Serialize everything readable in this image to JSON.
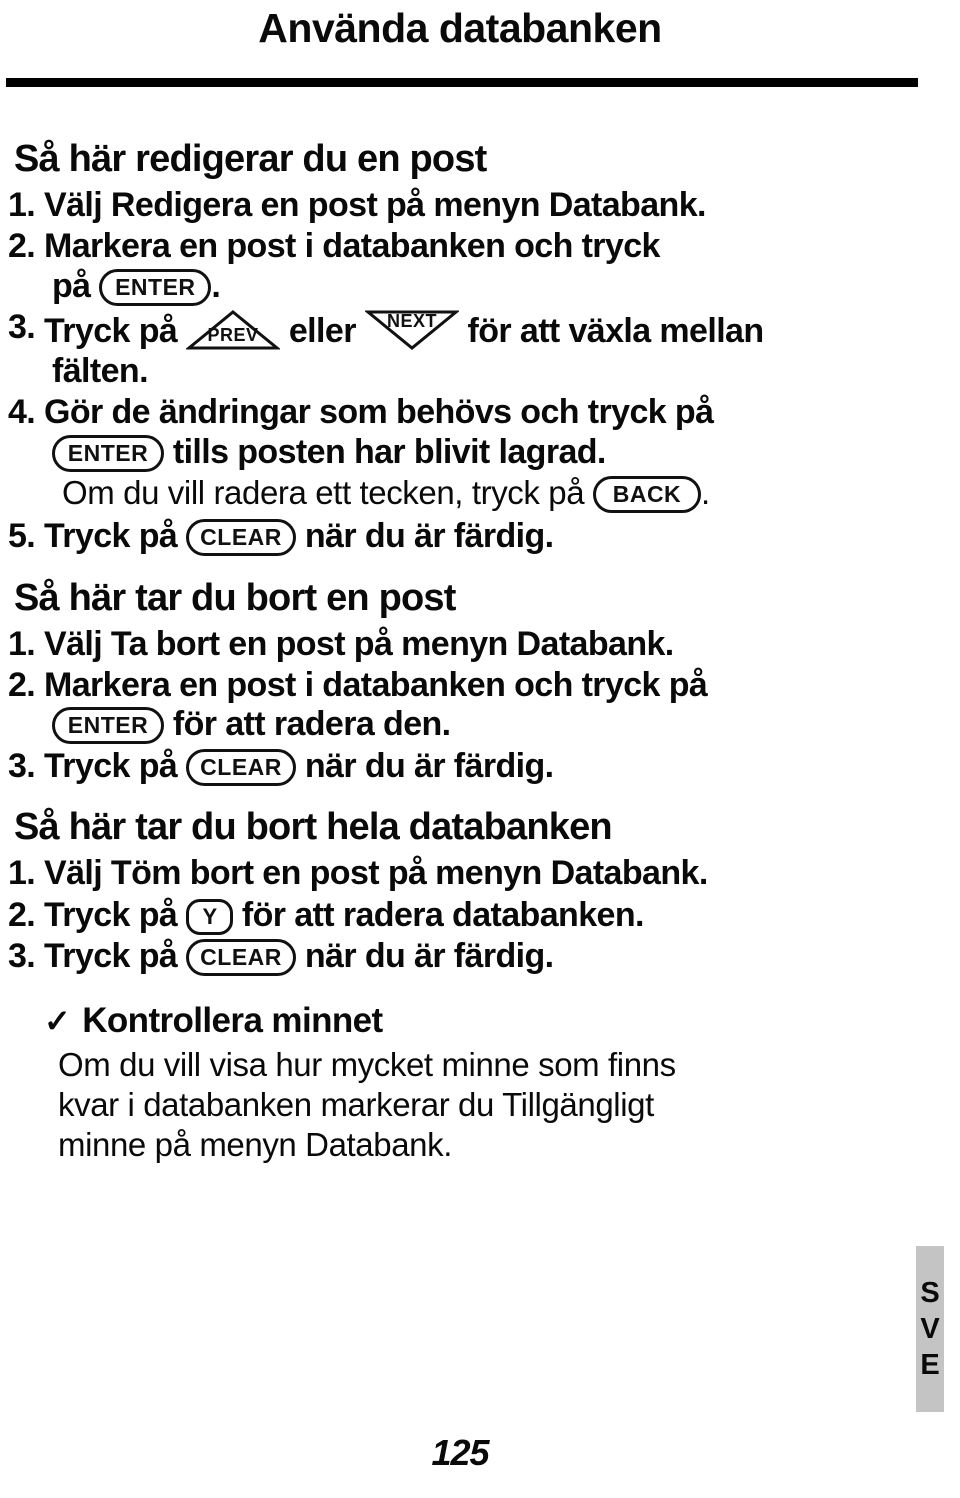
{
  "page": {
    "title": "Använda databanken",
    "folio": "125",
    "side_tab": {
      "letters": [
        "S",
        "V",
        "E"
      ],
      "background_color": "#c4c4c4"
    }
  },
  "sections": [
    {
      "heading": "Så här redigerar du en post",
      "steps": [
        {
          "number": "1.",
          "lines": [
            {
              "parts": [
                {
                  "type": "text",
                  "value": "Välj Redigera en post på menyn Databank."
                }
              ]
            }
          ]
        },
        {
          "number": "2.",
          "lines": [
            {
              "parts": [
                {
                  "type": "text",
                  "value": "Markera en post i databanken och tryck"
                }
              ]
            },
            {
              "parts": [
                {
                  "type": "text",
                  "value": "på "
                },
                {
                  "type": "key",
                  "value": "ENTER",
                  "shape": "pill"
                },
                {
                  "type": "text",
                  "value": "."
                }
              ]
            }
          ]
        },
        {
          "number": "3.",
          "lines": [
            {
              "parts": [
                {
                  "type": "text",
                  "value": "Tryck på "
                },
                {
                  "type": "key",
                  "value": "PREV",
                  "shape": "triangle-up"
                },
                {
                  "type": "text",
                  "value": " eller "
                },
                {
                  "type": "key",
                  "value": "NEXT",
                  "shape": "triangle-down"
                },
                {
                  "type": "text",
                  "value": " för att växla mellan"
                }
              ]
            },
            {
              "parts": [
                {
                  "type": "text",
                  "value": "fälten."
                }
              ]
            }
          ]
        },
        {
          "number": "4.",
          "lines": [
            {
              "parts": [
                {
                  "type": "text",
                  "value": "Gör de ändringar som behövs och tryck på"
                }
              ]
            },
            {
              "parts": [
                {
                  "type": "key",
                  "value": "ENTER",
                  "shape": "pill"
                },
                {
                  "type": "text",
                  "value": " tills posten har blivit lagrad."
                }
              ]
            }
          ],
          "note": {
            "parts": [
              {
                "type": "text",
                "value": "Om du vill radera ett tecken, tryck på "
              },
              {
                "type": "key",
                "value": "BACK",
                "shape": "pill"
              },
              {
                "type": "text",
                "value": "."
              }
            ]
          }
        },
        {
          "number": "5.",
          "lines": [
            {
              "parts": [
                {
                  "type": "text",
                  "value": "Tryck på "
                },
                {
                  "type": "key",
                  "value": "CLEAR",
                  "shape": "pill"
                },
                {
                  "type": "text",
                  "value": " när du är färdig."
                }
              ]
            }
          ]
        }
      ]
    },
    {
      "heading": "Så här tar du bort en post",
      "steps": [
        {
          "number": "1.",
          "lines": [
            {
              "parts": [
                {
                  "type": "text",
                  "value": "Välj Ta bort en post på menyn Databank."
                }
              ]
            }
          ]
        },
        {
          "number": "2.",
          "lines": [
            {
              "parts": [
                {
                  "type": "text",
                  "value": "Markera en post i databanken och tryck på"
                }
              ]
            },
            {
              "parts": [
                {
                  "type": "key",
                  "value": "ENTER",
                  "shape": "pill"
                },
                {
                  "type": "text",
                  "value": " för att radera den."
                }
              ]
            }
          ]
        },
        {
          "number": "3.",
          "lines": [
            {
              "parts": [
                {
                  "type": "text",
                  "value": "Tryck på "
                },
                {
                  "type": "key",
                  "value": "CLEAR",
                  "shape": "pill"
                },
                {
                  "type": "text",
                  "value": " när du är färdig."
                }
              ]
            }
          ]
        }
      ]
    },
    {
      "heading": "Så här tar du bort hela databanken",
      "steps": [
        {
          "number": "1.",
          "lines": [
            {
              "parts": [
                {
                  "type": "text",
                  "value": "Välj Töm bort en post på menyn Databank."
                }
              ]
            }
          ]
        },
        {
          "number": "2.",
          "lines": [
            {
              "parts": [
                {
                  "type": "text",
                  "value": "Tryck på "
                },
                {
                  "type": "key",
                  "value": "Y",
                  "shape": "pill-small"
                },
                {
                  "type": "text",
                  "value": " för att radera databanken."
                }
              ]
            }
          ]
        },
        {
          "number": "3.",
          "lines": [
            {
              "parts": [
                {
                  "type": "text",
                  "value": "Tryck på "
                },
                {
                  "type": "key",
                  "value": "CLEAR",
                  "shape": "pill"
                },
                {
                  "type": "text",
                  "value": " när du är färdig."
                }
              ]
            }
          ]
        }
      ]
    }
  ],
  "check_note": {
    "mark": "✓",
    "heading": "Kontrollera minnet",
    "lines": [
      "Om du vill visa hur mycket minne som finns",
      "kvar i databanken markerar du Tillgängligt",
      "minne på menyn Databank."
    ]
  }
}
